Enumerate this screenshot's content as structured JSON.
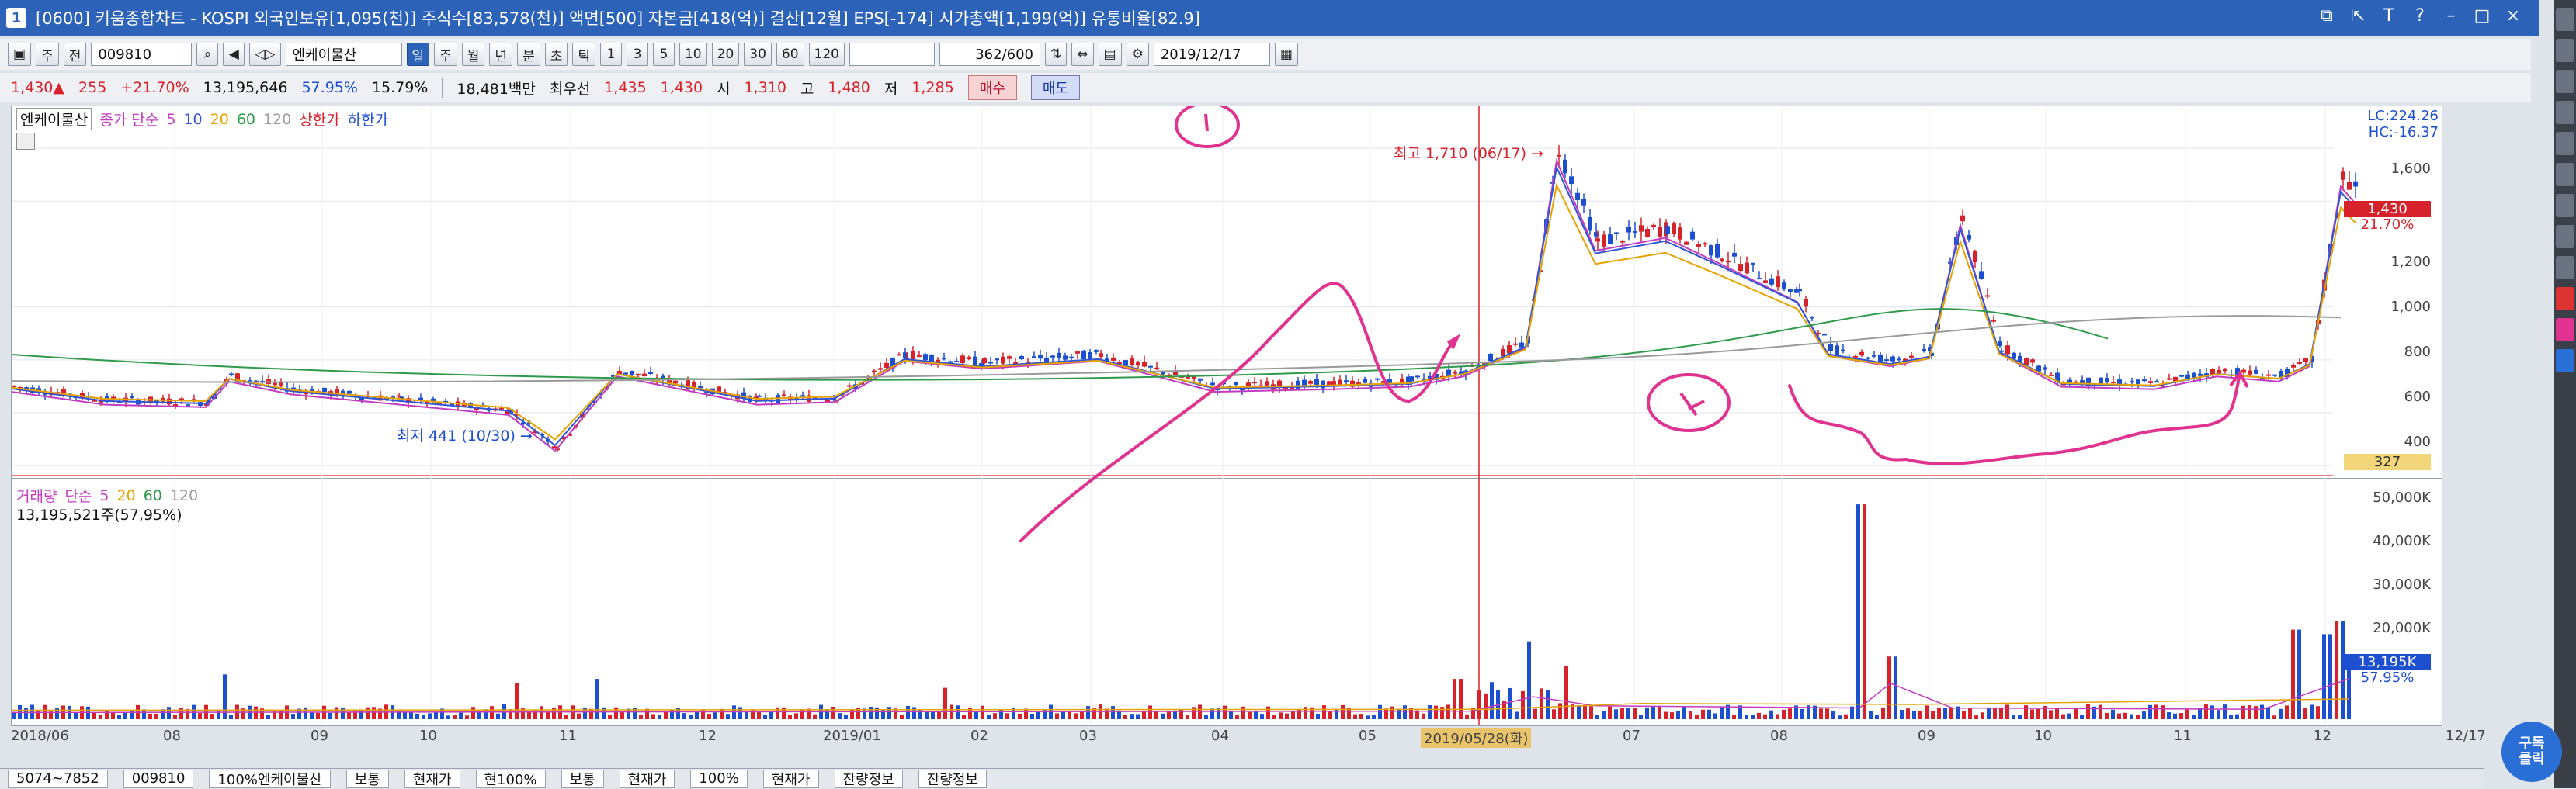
{
  "titlebar": {
    "text": "[0600] 키움종합차트 - KOSPI 외국인보유[1,095(천)] 주식수[83,578(천)] 액면[500] 자본금[418(억)] 결산[12월] EPS[-174] 시가총액[1,199(억)] 유통비율[82.9]",
    "window_number": "1"
  },
  "toolbar": {
    "market": "주",
    "all_label": "전",
    "stock_code": "009810",
    "stock_name": "엔케이물산",
    "period_tabs": [
      "일",
      "주",
      "월",
      "년",
      "분",
      "초",
      "틱"
    ],
    "active_period": "일",
    "interval_buttons": [
      "1",
      "3",
      "5",
      "10",
      "20",
      "30",
      "60",
      "120"
    ],
    "count": "362",
    "count_max": "/600",
    "date": "2019/12/17"
  },
  "quote": {
    "price": "1,430▲",
    "change": "255",
    "change_pct": "+21.70%",
    "volume": "13,195,646",
    "vol_pct": "57.95%",
    "turnover": "15.79%",
    "amount": "18,481백만",
    "priority_label": "최우선",
    "ask": "1,435",
    "bid": "1,430",
    "open_label": "시",
    "open": "1,310",
    "high_label": "고",
    "high": "1,480",
    "low_label": "저",
    "low": "1,285",
    "buy_label": "매수",
    "sell_label": "매도"
  },
  "price_panel": {
    "legend_stock": "엔케이물산",
    "legend_ma": "종가 단순",
    "ma_periods": [
      "5",
      "10",
      "20",
      "60",
      "120"
    ],
    "legend_upper": "상한가",
    "legend_lower": "하한가",
    "lc": "LC:224.26",
    "hc": "HC:-16.37",
    "high_annotation": "최고 1,710 (06/17) →",
    "low_annotation": "최저 441 (10/30) →",
    "current_price_tag": "1,430",
    "current_pct_tag": "21.70%",
    "bottom_tag": "327",
    "y_ticks": [
      "1,600",
      "1,400",
      "1,200",
      "1,000",
      "800",
      "600",
      "400"
    ]
  },
  "volume_panel": {
    "legend": "거래량",
    "legend_ma": "단순",
    "ma_periods": [
      "5",
      "20",
      "60",
      "120"
    ],
    "value_text": "13,195,521주(57,95%)",
    "y_ticks": [
      "50,000K",
      "40,000K",
      "30,000K",
      "20,000K"
    ],
    "current_tag": "13,195K",
    "current_pct": "57.95%"
  },
  "x_axis": {
    "labels": [
      "2018/06",
      "08",
      "09",
      "10",
      "11",
      "12",
      "2019/01",
      "02",
      "03",
      "04",
      "05",
      "2019/05/28(화)",
      "07",
      "08",
      "09",
      "10",
      "11",
      "12"
    ],
    "end_label": "12/17"
  },
  "statusbar": {
    "cells": [
      "5074~7852",
      "009810",
      "100%엔케이물산",
      "보통",
      "현재가",
      "현100%",
      "보통",
      "현재가",
      "100%",
      "현재가",
      "잔량정보",
      "잔량정보"
    ]
  },
  "watermark": "구독\n클릭",
  "colors": {
    "up": "#d8222b",
    "down": "#1d4fd1",
    "ma5": "#c23bc0",
    "ma10": "#3255d6",
    "ma20": "#e6a300",
    "ma60": "#2e9a4a",
    "ma120": "#9a9a9a",
    "annotation": "#e0338f",
    "title_bg": "#2c63b8"
  }
}
